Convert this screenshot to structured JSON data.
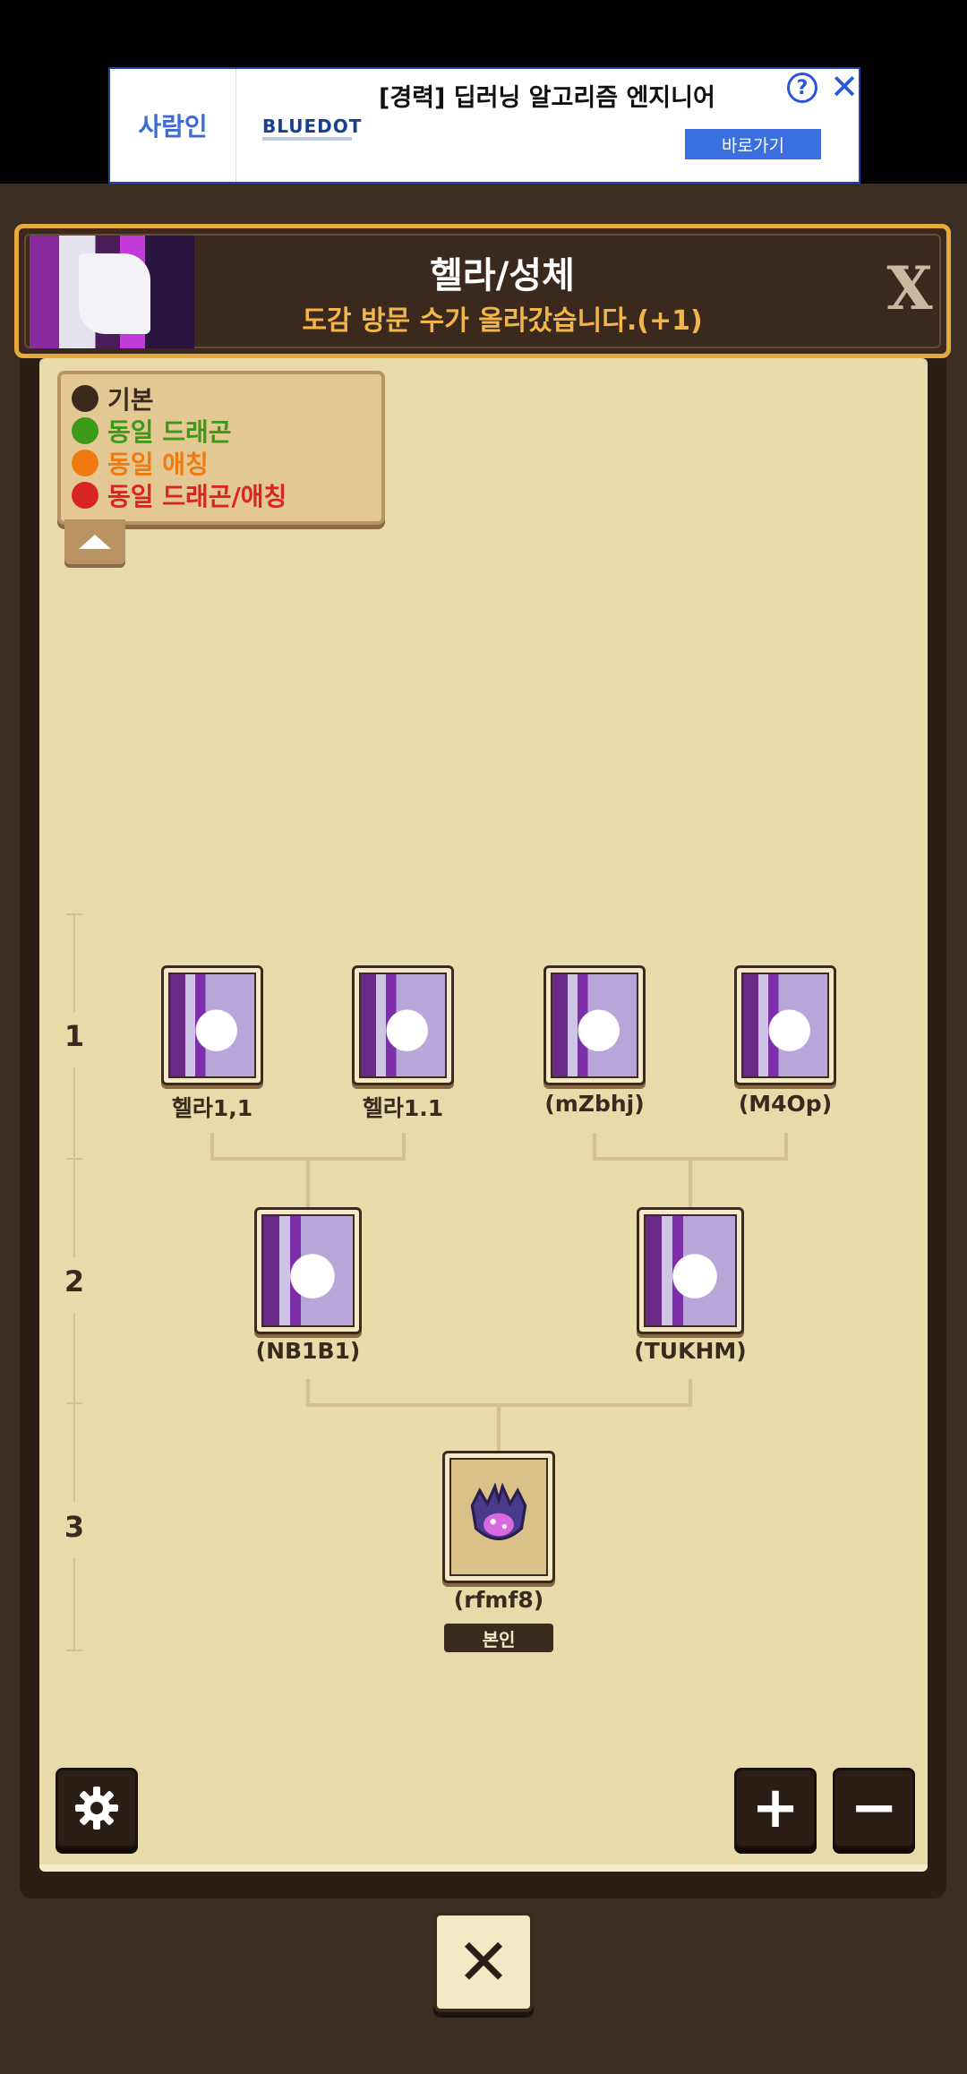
{
  "ad": {
    "brand": "사람인",
    "title": "[경력] 딥러닝 알고리즘 엔지니어",
    "logo": "BLUEDOT",
    "info_glyph": "?",
    "close_glyph": "✕",
    "cta": "바로가기"
  },
  "header": {
    "title": "헬라/성체",
    "subtitle": "도감 방문 수가 올라갔습니다.(+1)",
    "close_glyph": "X"
  },
  "legend": {
    "items": [
      {
        "label": "기본",
        "color": "#3a2a1e"
      },
      {
        "label": "동일 드래곤",
        "color": "#3d9a18"
      },
      {
        "label": "동일 애칭",
        "color": "#f07a10"
      },
      {
        "label": "동일 드래곤/애칭",
        "color": "#d92424"
      }
    ]
  },
  "generations": [
    "1",
    "2",
    "3"
  ],
  "tree": {
    "gen1": [
      "헬라1,1",
      "헬라1.1",
      "(mZbhj)",
      "(M4Op)"
    ],
    "gen2": [
      "(NB1B1)",
      "(TUKHM)"
    ],
    "gen3": [
      "(rfmf8)"
    ],
    "self_badge": "본인"
  },
  "controls": {
    "settings_icon": "gear-icon",
    "zoom_in_glyph": "+",
    "zoom_out_glyph": "−",
    "close_glyph": "✕"
  }
}
